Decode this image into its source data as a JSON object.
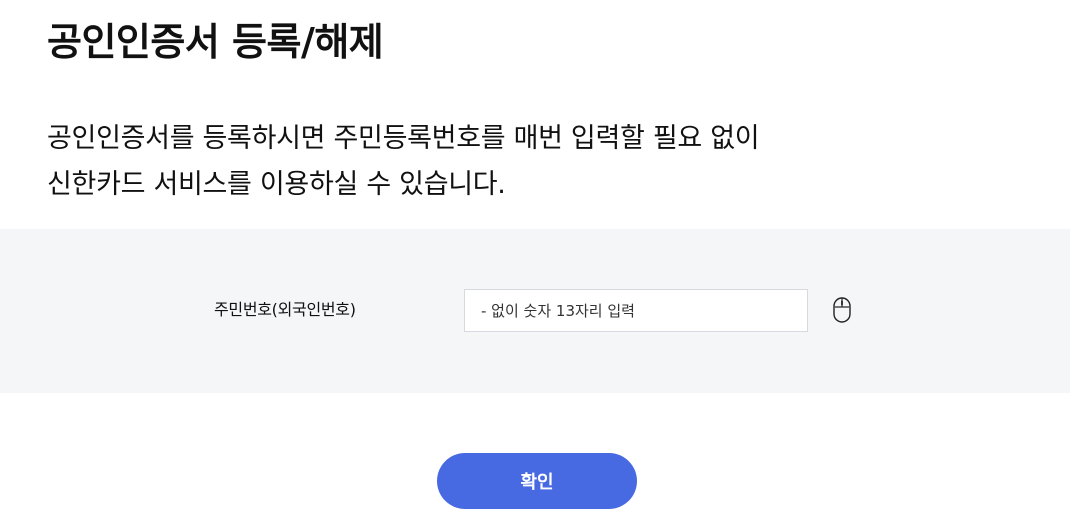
{
  "page": {
    "title": "공인인증서 등록/해제",
    "description_lines": [
      "공인인증서를 등록하시면 주민등록번호를 매번 입력할 필요 없이",
      "신한카드 서비스를 이용하실 수 있습니다."
    ]
  },
  "form": {
    "resident_number_label": "주민번호(외국인번호)",
    "resident_number_value": "",
    "resident_number_placeholder": "- 없이 숫자 13자리 입력",
    "mouse_input_icon": "mouse-icon"
  },
  "actions": {
    "confirm_label": "확인"
  },
  "colors": {
    "page_background": "#ffffff",
    "panel_background": "#f5f6f8",
    "primary_button": "#4769e2",
    "button_text": "#ffffff",
    "text": "#111111",
    "input_border": "#d7d9de"
  }
}
